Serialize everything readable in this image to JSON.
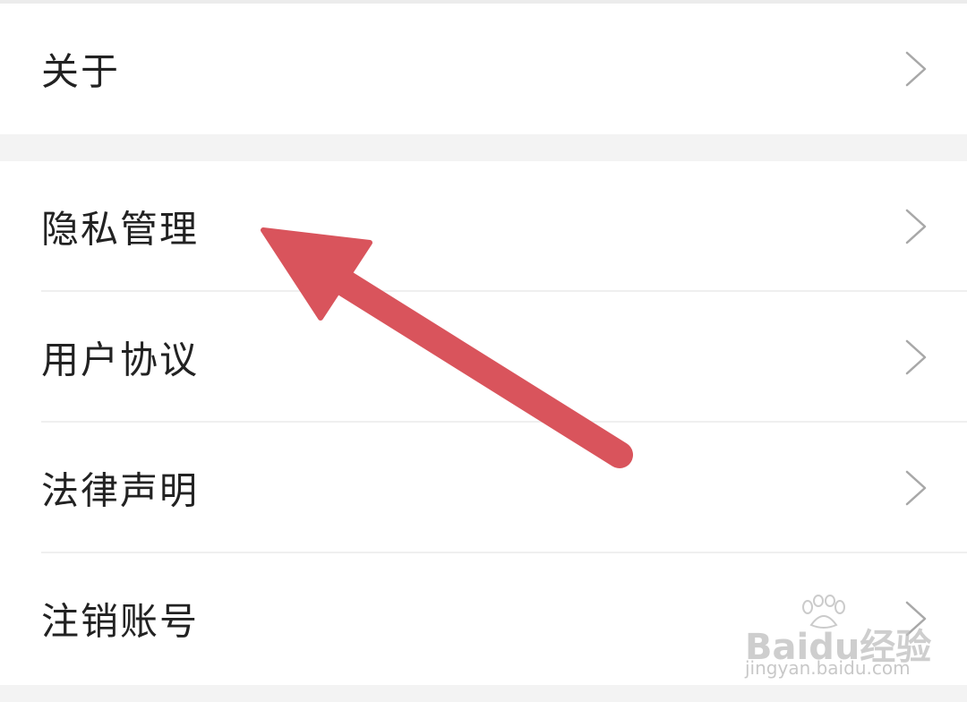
{
  "menu_group_1": [
    {
      "label": "关于",
      "icon": "chevron-right-icon"
    }
  ],
  "menu_group_2": [
    {
      "label": "隐私管理",
      "icon": "chevron-right-icon"
    },
    {
      "label": "用户协议",
      "icon": "chevron-right-icon"
    },
    {
      "label": "法律声明",
      "icon": "chevron-right-icon"
    },
    {
      "label": "注销账号",
      "icon": "chevron-right-icon"
    }
  ],
  "annotation": {
    "type": "arrow",
    "color": "#d9545c",
    "points_to": "隐私管理"
  },
  "watermark": {
    "brand": "Baidu经验",
    "url": "jingyan.baidu.com"
  },
  "colors": {
    "background": "#f3f3f3",
    "card": "#ffffff",
    "text": "#222222",
    "chevron": "#a8a8a8",
    "arrow": "#d9545c"
  }
}
